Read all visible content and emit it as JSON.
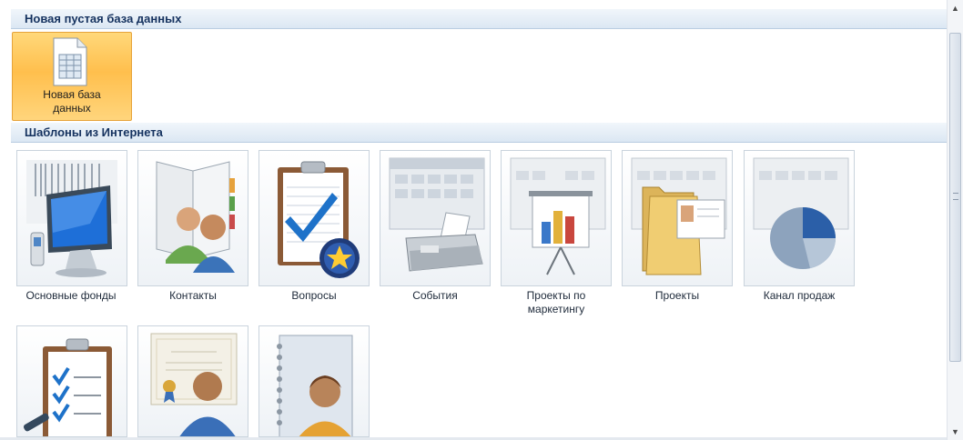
{
  "sections": {
    "blank": "Новая пустая база данных",
    "online": "Шаблоны из Интернета"
  },
  "new_db": {
    "label": "Новая база данных",
    "icon": "new-database-document-icon"
  },
  "templates": [
    {
      "label": "Основные фонды",
      "icon": "assets-computer-icon"
    },
    {
      "label": "Контакты",
      "icon": "contacts-people-icon"
    },
    {
      "label": "Вопросы",
      "icon": "issues-clipboard-icon"
    },
    {
      "label": "События",
      "icon": "events-fax-icon"
    },
    {
      "label": "Проекты по маркетингу",
      "icon": "marketing-chart-icon"
    },
    {
      "label": "Проекты",
      "icon": "projects-folder-icon"
    },
    {
      "label": "Канал продаж",
      "icon": "sales-pie-icon"
    },
    {
      "label": "",
      "icon": "tasks-checklist-icon"
    },
    {
      "label": "",
      "icon": "faculty-certificate-icon"
    },
    {
      "label": "",
      "icon": "students-notebook-icon"
    }
  ],
  "colors": {
    "accent": "#ffbf4d",
    "header_text": "#15325f",
    "header_bg": "#dbe7f3"
  }
}
